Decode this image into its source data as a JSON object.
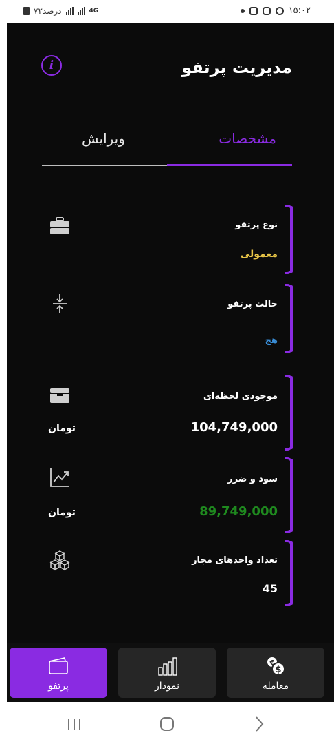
{
  "status_bar": {
    "time": "۱۵:۰۲",
    "battery_text": "۷۲درصد",
    "network": "4G",
    "icons": [
      "dot-icon",
      "gallery-icon",
      "instagram-icon",
      "whatsapp-icon",
      "battery-icon",
      "signal-icon"
    ]
  },
  "header": {
    "title": "مدیریت پرتفو",
    "info_icon": "info-icon"
  },
  "tabs": [
    {
      "label": "مشخصات",
      "active": true
    },
    {
      "label": "ویرایش",
      "active": false
    }
  ],
  "cards": [
    {
      "label": "نوع پرتفو",
      "value": "معمولی",
      "value_color": "#e8c547",
      "unit": "",
      "icon": "briefcase-icon"
    },
    {
      "label": "حالت پرتفو",
      "value": "هج",
      "value_color": "#3a8fd9",
      "unit": "",
      "icon": "compress-arrows-icon"
    },
    {
      "label": "موجودی لحظه‌ای",
      "value": "104,749,000",
      "value_color": "#ffffff",
      "unit": "تومان",
      "icon": "wallet-icon"
    },
    {
      "label": "سود و ضرر",
      "value": "89,749,000",
      "value_color": "#1f8a1f",
      "unit": "تومان",
      "icon": "trend-chart-icon"
    },
    {
      "label": "تعداد واحدهای مجاز",
      "value": "45",
      "value_color": "#ffffff",
      "unit": "",
      "icon": "cubes-icon"
    }
  ],
  "bottom_nav": [
    {
      "label": "پرتفو",
      "icon": "portfolio-icon",
      "active": true
    },
    {
      "label": "نمودار",
      "icon": "bar-chart-icon",
      "active": false
    },
    {
      "label": "معامله",
      "icon": "coins-icon",
      "active": false
    }
  ],
  "colors": {
    "accent": "#8a2be2",
    "background": "#0b0b0b",
    "nav_inactive": "#262626"
  }
}
